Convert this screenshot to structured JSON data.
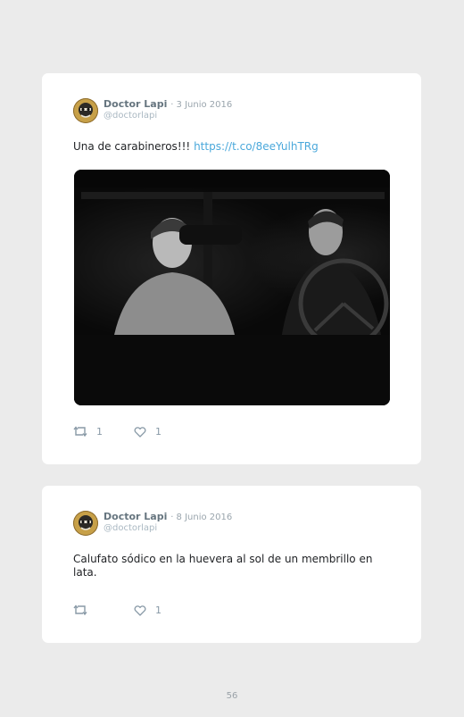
{
  "tweets": [
    {
      "author": "Doctor Lapi",
      "date": "· 3 Junio 2016",
      "handle": "@doctorlapi",
      "text": "Una de carabineros!!! ",
      "link": "https://t.co/8eeYulhTRg",
      "retweets": "1",
      "likes": "1",
      "media": "black-and-white film still of a woman and a man in a car at night"
    },
    {
      "author": "Doctor Lapi",
      "date": "· 8 Junio 2016",
      "handle": "@doctorlapi",
      "text": "Calufato sódico en la huevera al sol de un membrillo en lata.",
      "retweets": "",
      "likes": "1"
    }
  ],
  "page_number": "56",
  "icons": [
    "avatar-icon",
    "retweet-icon",
    "heart-icon"
  ],
  "colors": {
    "background": "#ebebeb",
    "card": "#ffffff",
    "link": "#4aa8db",
    "muted": "#8899a6"
  }
}
